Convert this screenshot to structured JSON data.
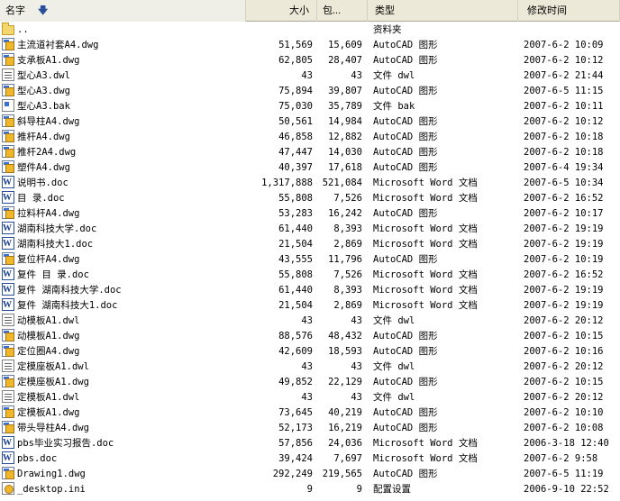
{
  "columns": {
    "name": "名字",
    "size": "大小",
    "packed": "包...",
    "type": "类型",
    "modified": "修改时间"
  },
  "files": [
    {
      "name": "..",
      "size": "",
      "packed": "",
      "type": "资料夹",
      "modified": "",
      "icon": "folder-icon"
    },
    {
      "name": "主流道衬套A4.dwg",
      "size": "51,569",
      "packed": "15,609",
      "type": "AutoCAD 图形",
      "modified": "2007-6-2 10:09",
      "icon": "dwg-file-icon"
    },
    {
      "name": "支承板A1.dwg",
      "size": "62,805",
      "packed": "28,407",
      "type": "AutoCAD 图形",
      "modified": "2007-6-2 10:12",
      "icon": "dwg-file-icon"
    },
    {
      "name": "型心A3.dwl",
      "size": "43",
      "packed": "43",
      "type": "文件 dwl",
      "modified": "2007-6-2 21:44",
      "icon": "dwl-file-icon"
    },
    {
      "name": "型心A3.dwg",
      "size": "75,894",
      "packed": "39,807",
      "type": "AutoCAD 图形",
      "modified": "2007-6-5 11:15",
      "icon": "dwg-file-icon"
    },
    {
      "name": "型心A3.bak",
      "size": "75,030",
      "packed": "35,789",
      "type": "文件 bak",
      "modified": "2007-6-2 10:11",
      "icon": "bak-file-icon"
    },
    {
      "name": "斜导柱A4.dwg",
      "size": "50,561",
      "packed": "14,984",
      "type": "AutoCAD 图形",
      "modified": "2007-6-2 10:12",
      "icon": "dwg-file-icon"
    },
    {
      "name": "推杆A4.dwg",
      "size": "46,858",
      "packed": "12,882",
      "type": "AutoCAD 图形",
      "modified": "2007-6-2 10:18",
      "icon": "dwg-file-icon"
    },
    {
      "name": "推杆2A4.dwg",
      "size": "47,447",
      "packed": "14,030",
      "type": "AutoCAD 图形",
      "modified": "2007-6-2 10:18",
      "icon": "dwg-file-icon"
    },
    {
      "name": "塑件A4.dwg",
      "size": "40,397",
      "packed": "17,618",
      "type": "AutoCAD 图形",
      "modified": "2007-6-4 19:34",
      "icon": "dwg-file-icon"
    },
    {
      "name": "说明书.doc",
      "size": "1,317,888",
      "packed": "521,084",
      "type": "Microsoft Word 文档",
      "modified": "2007-6-5 10:34",
      "icon": "word-doc-icon"
    },
    {
      "name": "目 录.doc",
      "size": "55,808",
      "packed": "7,526",
      "type": "Microsoft Word 文档",
      "modified": "2007-6-2 16:52",
      "icon": "word-doc-icon"
    },
    {
      "name": "拉料杆A4.dwg",
      "size": "53,283",
      "packed": "16,242",
      "type": "AutoCAD 图形",
      "modified": "2007-6-2 10:17",
      "icon": "dwg-file-icon"
    },
    {
      "name": "湖南科技大学.doc",
      "size": "61,440",
      "packed": "8,393",
      "type": "Microsoft Word 文档",
      "modified": "2007-6-2 19:19",
      "icon": "word-doc-icon"
    },
    {
      "name": "湖南科技大1.doc",
      "size": "21,504",
      "packed": "2,869",
      "type": "Microsoft Word 文档",
      "modified": "2007-6-2 19:19",
      "icon": "word-doc-icon"
    },
    {
      "name": "复位杆A4.dwg",
      "size": "43,555",
      "packed": "11,796",
      "type": "AutoCAD 图形",
      "modified": "2007-6-2 10:19",
      "icon": "dwg-file-icon"
    },
    {
      "name": "复件 目 录.doc",
      "size": "55,808",
      "packed": "7,526",
      "type": "Microsoft Word 文档",
      "modified": "2007-6-2 16:52",
      "icon": "word-doc-icon"
    },
    {
      "name": "复件 湖南科技大学.doc",
      "size": "61,440",
      "packed": "8,393",
      "type": "Microsoft Word 文档",
      "modified": "2007-6-2 19:19",
      "icon": "word-doc-icon"
    },
    {
      "name": "复件 湖南科技大1.doc",
      "size": "21,504",
      "packed": "2,869",
      "type": "Microsoft Word 文档",
      "modified": "2007-6-2 19:19",
      "icon": "word-doc-icon"
    },
    {
      "name": "动模板A1.dwl",
      "size": "43",
      "packed": "43",
      "type": "文件 dwl",
      "modified": "2007-6-2 20:12",
      "icon": "dwl-file-icon"
    },
    {
      "name": "动模板A1.dwg",
      "size": "88,576",
      "packed": "48,432",
      "type": "AutoCAD 图形",
      "modified": "2007-6-2 10:15",
      "icon": "dwg-file-icon"
    },
    {
      "name": "定位圈A4.dwg",
      "size": "42,609",
      "packed": "18,593",
      "type": "AutoCAD 图形",
      "modified": "2007-6-2 10:16",
      "icon": "dwg-file-icon"
    },
    {
      "name": "定模座板A1.dwl",
      "size": "43",
      "packed": "43",
      "type": "文件 dwl",
      "modified": "2007-6-2 20:12",
      "icon": "dwl-file-icon"
    },
    {
      "name": "定模座板A1.dwg",
      "size": "49,852",
      "packed": "22,129",
      "type": "AutoCAD 图形",
      "modified": "2007-6-2 10:15",
      "icon": "dwg-file-icon"
    },
    {
      "name": "定模板A1.dwl",
      "size": "43",
      "packed": "43",
      "type": "文件 dwl",
      "modified": "2007-6-2 20:12",
      "icon": "dwl-file-icon"
    },
    {
      "name": "定模板A1.dwg",
      "size": "73,645",
      "packed": "40,219",
      "type": "AutoCAD 图形",
      "modified": "2007-6-2 10:10",
      "icon": "dwg-file-icon"
    },
    {
      "name": "带头导柱A4.dwg",
      "size": "52,173",
      "packed": "16,219",
      "type": "AutoCAD 图形",
      "modified": "2007-6-2 10:08",
      "icon": "dwg-file-icon"
    },
    {
      "name": "pbs毕业实习报告.doc",
      "size": "57,856",
      "packed": "24,036",
      "type": "Microsoft Word 文档",
      "modified": "2006-3-18 12:40",
      "icon": "word-doc-icon"
    },
    {
      "name": "pbs.doc",
      "size": "39,424",
      "packed": "7,697",
      "type": "Microsoft Word 文档",
      "modified": "2007-6-2 9:58",
      "icon": "word-doc-icon"
    },
    {
      "name": "Drawing1.dwg",
      "size": "292,249",
      "packed": "219,565",
      "type": "AutoCAD 图形",
      "modified": "2007-6-5 11:19",
      "icon": "dwg-file-icon"
    },
    {
      "name": "_desktop.ini",
      "size": "9",
      "packed": "9",
      "type": "配置设置",
      "modified": "2006-9-10 22:52",
      "icon": "ini-file-icon"
    }
  ]
}
